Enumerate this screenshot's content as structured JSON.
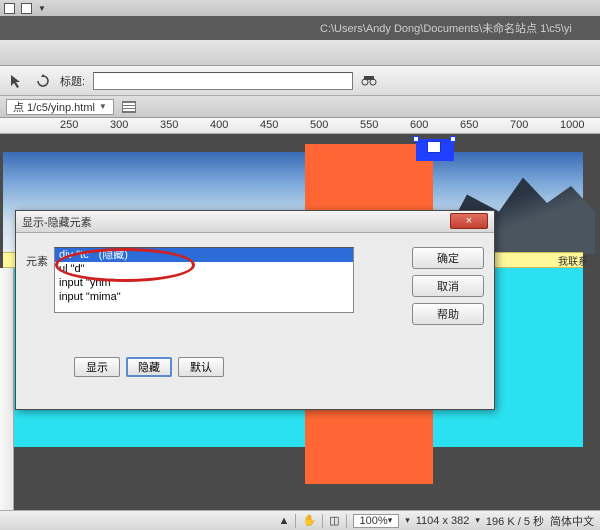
{
  "topbar": {
    "icons": [
      "box",
      "boxes"
    ]
  },
  "titlebar": {
    "path": "C:\\Users\\Andy Dong\\Documents\\未命名站点 1\\c5\\yi"
  },
  "toolbar": {
    "title_label": "标题:",
    "title_value": ""
  },
  "tabbar": {
    "tab_label": "点 1/c5/yinp.html"
  },
  "ruler": {
    "marks": [
      {
        "pos": 60,
        "val": "250"
      },
      {
        "pos": 110,
        "val": "300"
      },
      {
        "pos": 160,
        "val": "350"
      },
      {
        "pos": 210,
        "val": "400"
      },
      {
        "pos": 260,
        "val": "450"
      },
      {
        "pos": 310,
        "val": "500"
      },
      {
        "pos": 360,
        "val": "550"
      },
      {
        "pos": 410,
        "val": "600"
      },
      {
        "pos": 460,
        "val": "650"
      },
      {
        "pos": 510,
        "val": "700"
      },
      {
        "pos": 560,
        "val": "1000"
      }
    ]
  },
  "canvas": {
    "yellow_label": "我联系"
  },
  "dialog": {
    "title": "显示-隐藏元素",
    "close": "×",
    "label": "元素",
    "items": [
      {
        "text": "div \"tc\"  (隐藏)",
        "selected": true
      },
      {
        "text": "ul \"d\"",
        "selected": false
      },
      {
        "text": "input \"yhm\"",
        "selected": false
      },
      {
        "text": "input \"mima\"",
        "selected": false
      }
    ],
    "ok": "确定",
    "cancel": "取消",
    "help": "帮助",
    "show": "显示",
    "hide": "隐藏",
    "default": "默认"
  },
  "statusbar": {
    "zoom": "100%",
    "dims": "1104 x 382",
    "size_time": "196 K / 5 秒",
    "encoding": "简体中文"
  }
}
